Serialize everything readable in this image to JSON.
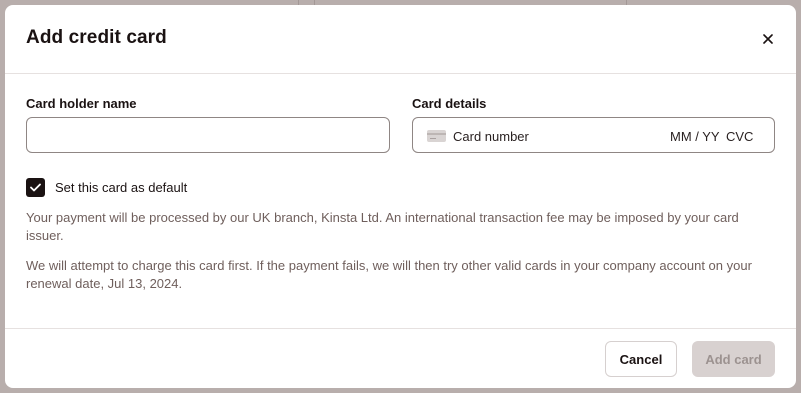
{
  "modal": {
    "title": "Add credit card",
    "close_icon": "close-icon"
  },
  "form": {
    "card_holder": {
      "label": "Card holder name",
      "value": ""
    },
    "card_details": {
      "label": "Card details",
      "card_icon": "credit-card-icon",
      "number_placeholder": "Card number",
      "expiry_placeholder": "MM / YY",
      "cvc_placeholder": "CVC"
    },
    "default_checkbox": {
      "label": "Set this card as default",
      "checked": true
    }
  },
  "info": {
    "paragraph1": "Your payment will be processed by our UK branch, Kinsta Ltd. An international transaction fee may be imposed by your card issuer.",
    "paragraph2": "We will attempt to charge this card first. If the payment fails, we will then try other valid cards in your company account on your renewal date, Jul 13, 2024."
  },
  "footer": {
    "cancel_label": "Cancel",
    "add_label": "Add card"
  },
  "colors": {
    "primary_dark": "#1a1212",
    "muted_text": "#6f5f5c",
    "disabled_button": "#d8d1d0",
    "backdrop": "#b8aeac"
  }
}
